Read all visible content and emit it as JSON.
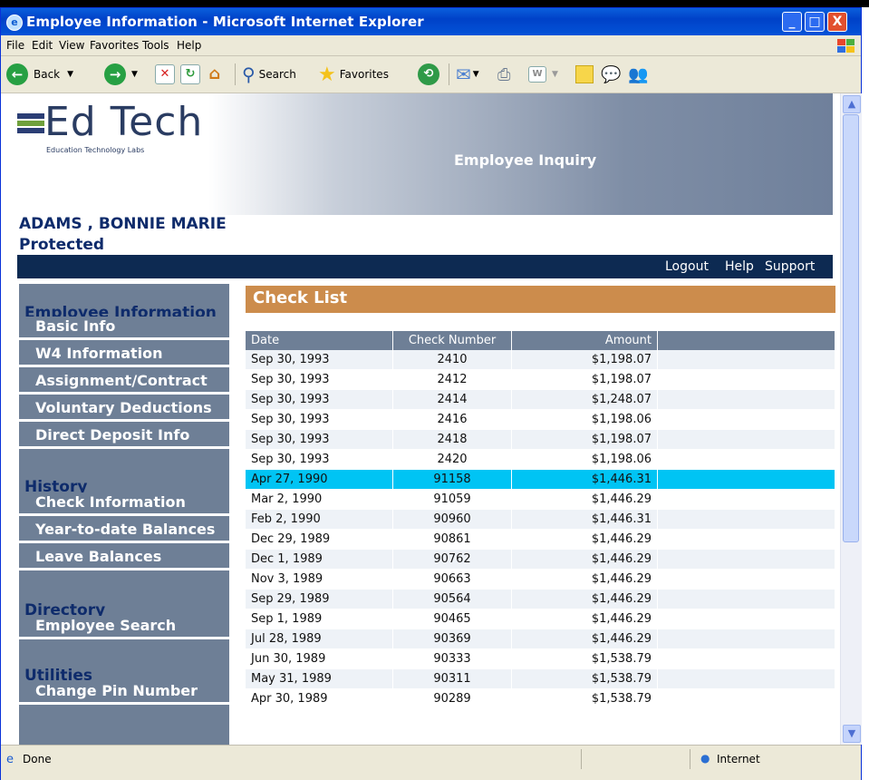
{
  "window": {
    "title": "Employee Information - Microsoft Internet Explorer",
    "minimize": "_",
    "maximize": "□",
    "close": "X"
  },
  "menu": [
    "File",
    "Edit",
    "View",
    "Favorites",
    "Tools",
    "Help"
  ],
  "toolbar": {
    "back": "Back",
    "search": "Search",
    "favorites": "Favorites"
  },
  "banner": {
    "logo": "Ed Tech",
    "logo_sub": "Education Technology Labs",
    "title": "Employee Inquiry"
  },
  "employee": {
    "name": "ADAMS , BONNIE  MARIE",
    "status": "Protected"
  },
  "topnav": [
    "Logout",
    "Help",
    "Support"
  ],
  "sidebar": {
    "sections": [
      {
        "heading": "Employee Information",
        "items": [
          "Basic Info",
          "W4 Information",
          "Assignment/Contract",
          "Voluntary Deductions",
          "Direct Deposit Info"
        ]
      },
      {
        "heading": "History",
        "items": [
          "Check Information",
          "Year-to-date Balances",
          "Leave Balances"
        ]
      },
      {
        "heading": "Directory",
        "items": [
          "Employee Search"
        ]
      },
      {
        "heading": "Utilities",
        "items": [
          "Change Pin Number"
        ]
      }
    ]
  },
  "main": {
    "section_title": "Check List",
    "columns": [
      "Date",
      "Check Number",
      "Amount"
    ],
    "rows": [
      [
        "Sep 30, 1993",
        "2410",
        "$1,198.07"
      ],
      [
        "Sep 30, 1993",
        "2412",
        "$1,198.07"
      ],
      [
        "Sep 30, 1993",
        "2414",
        "$1,248.07"
      ],
      [
        "Sep 30, 1993",
        "2416",
        "$1,198.06"
      ],
      [
        "Sep 30, 1993",
        "2418",
        "$1,198.07"
      ],
      [
        "Sep 30, 1993",
        "2420",
        "$1,198.06"
      ],
      [
        "Apr 27, 1990",
        "91158",
        "$1,446.31"
      ],
      [
        "Mar 2, 1990",
        "91059",
        "$1,446.29"
      ],
      [
        "Feb 2, 1990",
        "90960",
        "$1,446.31"
      ],
      [
        "Dec 29, 1989",
        "90861",
        "$1,446.29"
      ],
      [
        "Dec 1, 1989",
        "90762",
        "$1,446.29"
      ],
      [
        "Nov 3, 1989",
        "90663",
        "$1,446.29"
      ],
      [
        "Sep 29, 1989",
        "90564",
        "$1,446.29"
      ],
      [
        "Sep 1, 1989",
        "90465",
        "$1,446.29"
      ],
      [
        "Jul 28, 1989",
        "90369",
        "$1,446.29"
      ],
      [
        "Jun 30, 1989",
        "90333",
        "$1,538.79"
      ],
      [
        "May 31, 1989",
        "90311",
        "$1,538.79"
      ],
      [
        "Apr 30, 1989",
        "90289",
        "$1,538.79"
      ]
    ],
    "selected_row": 6
  },
  "status": {
    "left": "Done",
    "zone": "Internet"
  },
  "colors": {
    "accent_orange": "#cc8c4c",
    "sidebar": "#6e7f96",
    "navbar": "#0d2a52",
    "selection": "#00c4f4"
  }
}
